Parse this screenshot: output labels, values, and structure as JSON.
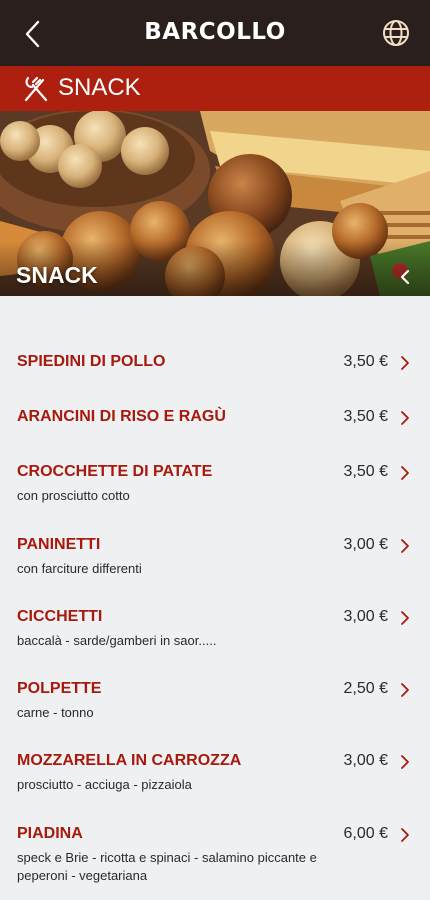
{
  "header": {
    "brand": "BARCOLLO",
    "back_icon": "chevron-left-icon",
    "language_icon": "globe-icon"
  },
  "category": {
    "title": "SNACK",
    "icon": "cutlery-icon",
    "banner_title": "SNACK"
  },
  "colors": {
    "topbar": "#2b1f1d",
    "category_bar": "#ad2010",
    "item_name": "#a8190d",
    "background": "#eff0f2"
  },
  "menu": {
    "items": [
      {
        "name": "SPIEDINI DI POLLO",
        "price": "3,50 €",
        "desc": ""
      },
      {
        "name": "ARANCINI DI RISO E RAGÙ",
        "price": "3,50 €",
        "desc": ""
      },
      {
        "name": "CROCCHETTE DI PATATE",
        "price": "3,50 €",
        "desc": "con prosciutto cotto"
      },
      {
        "name": "PANINETTI",
        "price": "3,00 €",
        "desc": "con farciture differenti"
      },
      {
        "name": "CICCHETTI",
        "price": "3,00 €",
        "desc": "baccalà - sarde/gamberi in saor....."
      },
      {
        "name": "POLPETTE",
        "price": "2,50 €",
        "desc": "carne - tonno"
      },
      {
        "name": "MOZZARELLA IN CARROZZA",
        "price": "3,00 €",
        "desc": "prosciutto - acciuga - pizzaiola"
      },
      {
        "name": "PIADINA",
        "price": "6,00 €",
        "desc": "speck e Brie - ricotta e spinaci - salamino piccante e peperoni - vegetariana"
      }
    ]
  }
}
